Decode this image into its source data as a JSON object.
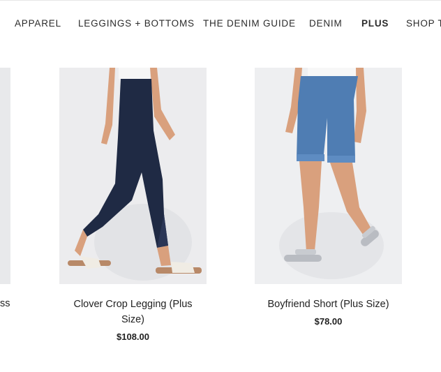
{
  "nav": {
    "items": [
      "APPAREL",
      "LEGGINGS + BOTTOMS",
      "THE DENIM GUIDE",
      "DENIM",
      "PLUS",
      "SHOP T"
    ],
    "active_index": 4
  },
  "products": {
    "left_partial_title_fragment": "ss",
    "items": [
      {
        "title_line1": "Clover Crop Legging (Plus",
        "title_line2": "Size)",
        "price": "$108.00"
      },
      {
        "title_line1": "Boyfriend Short (Plus Size)",
        "title_line2": "",
        "price": "$78.00"
      }
    ]
  },
  "colors": {
    "legging": "#1f2a44",
    "denim": "#4f7db3",
    "sandal_white": "#f0ece4",
    "sandal_silver": "#b9bcc2",
    "skin": "#d9a07d"
  }
}
